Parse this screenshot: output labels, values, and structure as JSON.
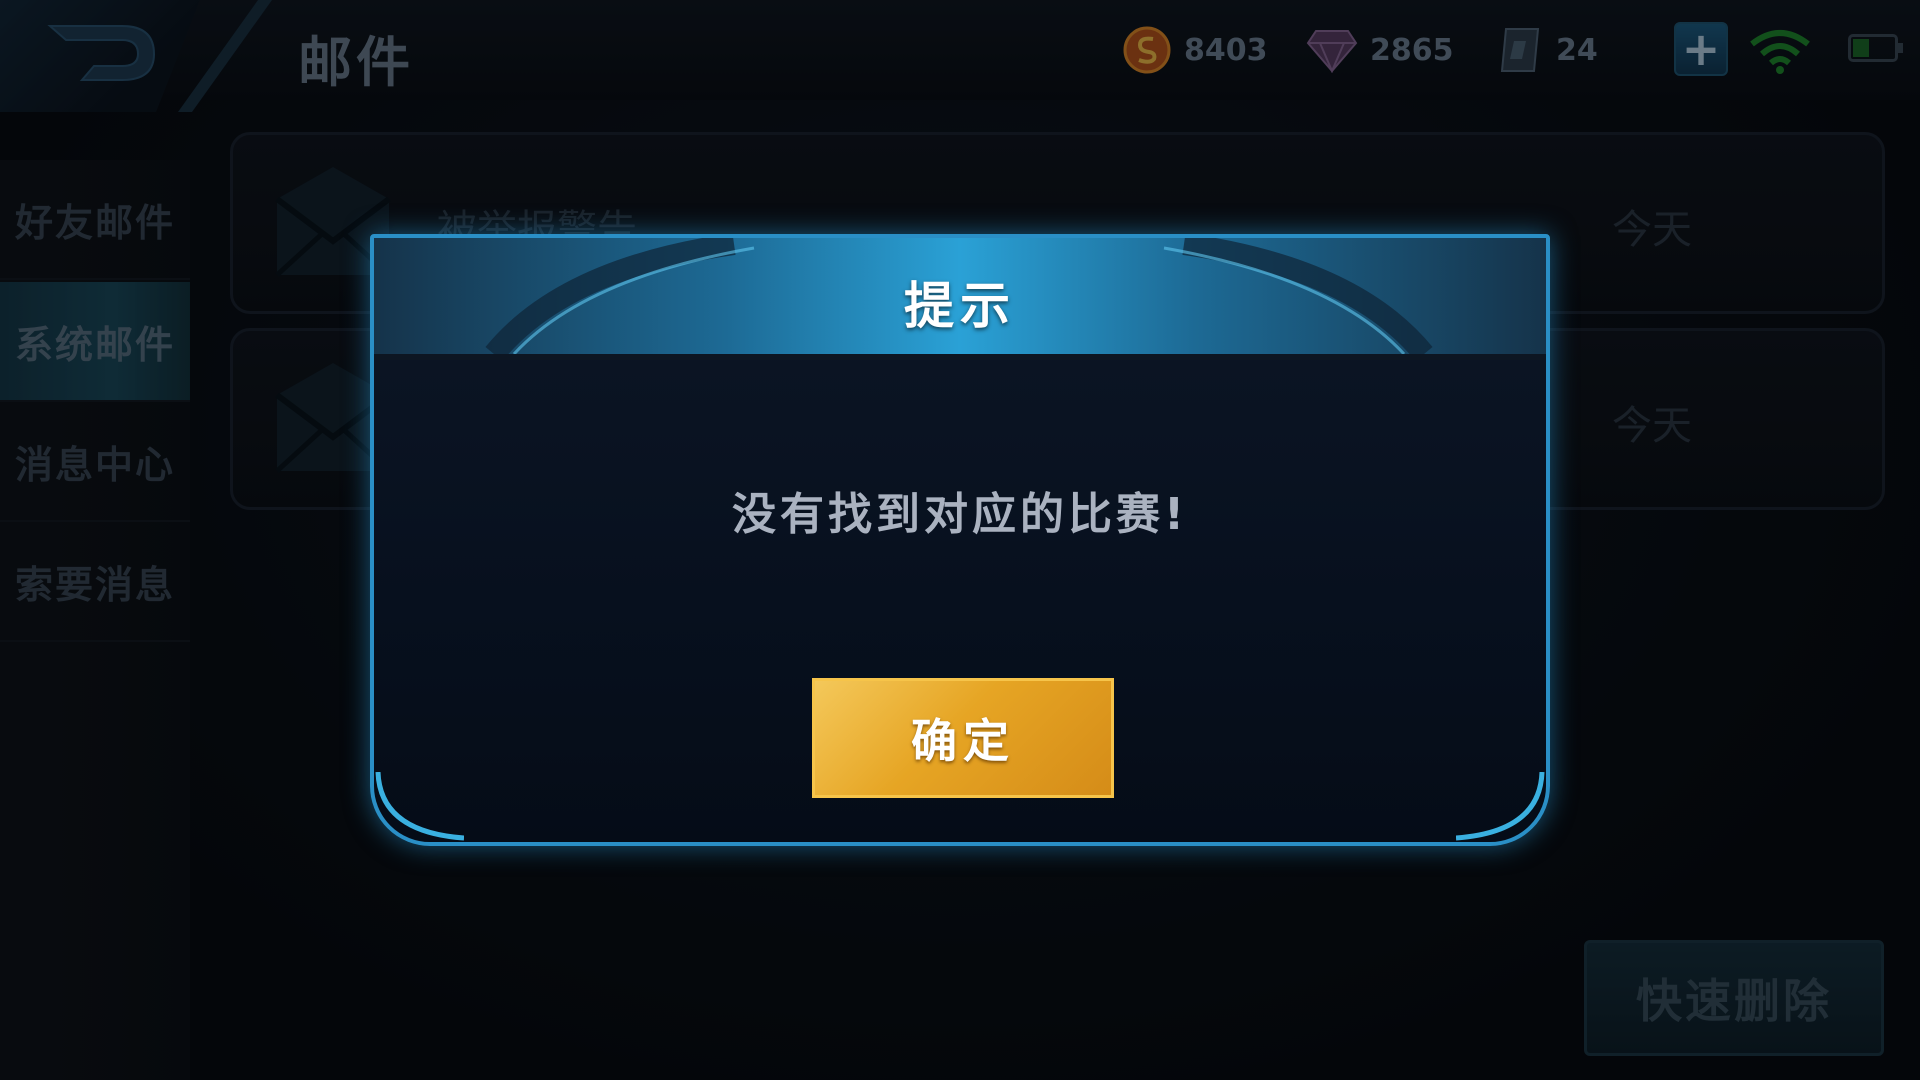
{
  "header": {
    "title": "邮件",
    "back_icon": "back-arrow-icon",
    "currencies": [
      {
        "name": "gold",
        "icon": "gold-coin-icon",
        "value": "8403"
      },
      {
        "name": "gem",
        "icon": "diamond-icon",
        "value": "2865"
      },
      {
        "name": "ticket",
        "icon": "coupon-icon",
        "value": "24"
      }
    ],
    "plus_label": "+",
    "battery_level": 0.4
  },
  "sidebar": {
    "items": [
      {
        "label": "好友邮件",
        "active": false
      },
      {
        "label": "系统邮件",
        "active": true
      },
      {
        "label": "消息中心",
        "active": false
      },
      {
        "label": "索要消息",
        "active": false
      }
    ]
  },
  "mail_list": [
    {
      "subject": "被举报警告",
      "date": "今天",
      "icon": "envelope-icon"
    },
    {
      "subject": "",
      "date": "今天",
      "icon": "envelope-icon"
    }
  ],
  "quick_delete_label": "快速删除",
  "dialog": {
    "title": "提示",
    "message": "没有找到对应的比赛!",
    "confirm_label": "确定"
  },
  "colors": {
    "accent": "#2a8fc6",
    "button_gold": "#e6a524",
    "wifi_green": "#1f8a2f"
  }
}
